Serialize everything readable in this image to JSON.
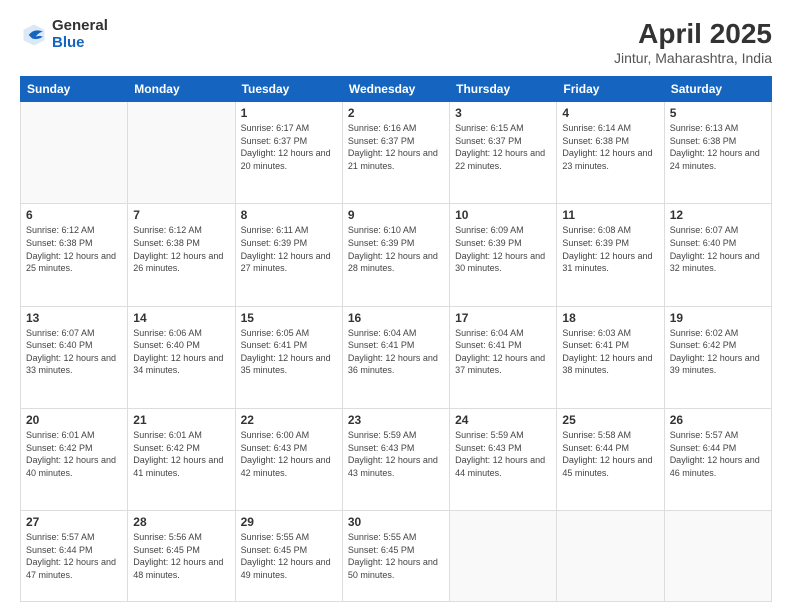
{
  "logo": {
    "general": "General",
    "blue": "Blue"
  },
  "header": {
    "title": "April 2025",
    "subtitle": "Jintur, Maharashtra, India"
  },
  "days": [
    "Sunday",
    "Monday",
    "Tuesday",
    "Wednesday",
    "Thursday",
    "Friday",
    "Saturday"
  ],
  "weeks": [
    [
      {
        "day": "",
        "info": ""
      },
      {
        "day": "",
        "info": ""
      },
      {
        "day": "1",
        "info": "Sunrise: 6:17 AM\nSunset: 6:37 PM\nDaylight: 12 hours and 20 minutes."
      },
      {
        "day": "2",
        "info": "Sunrise: 6:16 AM\nSunset: 6:37 PM\nDaylight: 12 hours and 21 minutes."
      },
      {
        "day": "3",
        "info": "Sunrise: 6:15 AM\nSunset: 6:37 PM\nDaylight: 12 hours and 22 minutes."
      },
      {
        "day": "4",
        "info": "Sunrise: 6:14 AM\nSunset: 6:38 PM\nDaylight: 12 hours and 23 minutes."
      },
      {
        "day": "5",
        "info": "Sunrise: 6:13 AM\nSunset: 6:38 PM\nDaylight: 12 hours and 24 minutes."
      }
    ],
    [
      {
        "day": "6",
        "info": "Sunrise: 6:12 AM\nSunset: 6:38 PM\nDaylight: 12 hours and 25 minutes."
      },
      {
        "day": "7",
        "info": "Sunrise: 6:12 AM\nSunset: 6:38 PM\nDaylight: 12 hours and 26 minutes."
      },
      {
        "day": "8",
        "info": "Sunrise: 6:11 AM\nSunset: 6:39 PM\nDaylight: 12 hours and 27 minutes."
      },
      {
        "day": "9",
        "info": "Sunrise: 6:10 AM\nSunset: 6:39 PM\nDaylight: 12 hours and 28 minutes."
      },
      {
        "day": "10",
        "info": "Sunrise: 6:09 AM\nSunset: 6:39 PM\nDaylight: 12 hours and 30 minutes."
      },
      {
        "day": "11",
        "info": "Sunrise: 6:08 AM\nSunset: 6:39 PM\nDaylight: 12 hours and 31 minutes."
      },
      {
        "day": "12",
        "info": "Sunrise: 6:07 AM\nSunset: 6:40 PM\nDaylight: 12 hours and 32 minutes."
      }
    ],
    [
      {
        "day": "13",
        "info": "Sunrise: 6:07 AM\nSunset: 6:40 PM\nDaylight: 12 hours and 33 minutes."
      },
      {
        "day": "14",
        "info": "Sunrise: 6:06 AM\nSunset: 6:40 PM\nDaylight: 12 hours and 34 minutes."
      },
      {
        "day": "15",
        "info": "Sunrise: 6:05 AM\nSunset: 6:41 PM\nDaylight: 12 hours and 35 minutes."
      },
      {
        "day": "16",
        "info": "Sunrise: 6:04 AM\nSunset: 6:41 PM\nDaylight: 12 hours and 36 minutes."
      },
      {
        "day": "17",
        "info": "Sunrise: 6:04 AM\nSunset: 6:41 PM\nDaylight: 12 hours and 37 minutes."
      },
      {
        "day": "18",
        "info": "Sunrise: 6:03 AM\nSunset: 6:41 PM\nDaylight: 12 hours and 38 minutes."
      },
      {
        "day": "19",
        "info": "Sunrise: 6:02 AM\nSunset: 6:42 PM\nDaylight: 12 hours and 39 minutes."
      }
    ],
    [
      {
        "day": "20",
        "info": "Sunrise: 6:01 AM\nSunset: 6:42 PM\nDaylight: 12 hours and 40 minutes."
      },
      {
        "day": "21",
        "info": "Sunrise: 6:01 AM\nSunset: 6:42 PM\nDaylight: 12 hours and 41 minutes."
      },
      {
        "day": "22",
        "info": "Sunrise: 6:00 AM\nSunset: 6:43 PM\nDaylight: 12 hours and 42 minutes."
      },
      {
        "day": "23",
        "info": "Sunrise: 5:59 AM\nSunset: 6:43 PM\nDaylight: 12 hours and 43 minutes."
      },
      {
        "day": "24",
        "info": "Sunrise: 5:59 AM\nSunset: 6:43 PM\nDaylight: 12 hours and 44 minutes."
      },
      {
        "day": "25",
        "info": "Sunrise: 5:58 AM\nSunset: 6:44 PM\nDaylight: 12 hours and 45 minutes."
      },
      {
        "day": "26",
        "info": "Sunrise: 5:57 AM\nSunset: 6:44 PM\nDaylight: 12 hours and 46 minutes."
      }
    ],
    [
      {
        "day": "27",
        "info": "Sunrise: 5:57 AM\nSunset: 6:44 PM\nDaylight: 12 hours and 47 minutes."
      },
      {
        "day": "28",
        "info": "Sunrise: 5:56 AM\nSunset: 6:45 PM\nDaylight: 12 hours and 48 minutes."
      },
      {
        "day": "29",
        "info": "Sunrise: 5:55 AM\nSunset: 6:45 PM\nDaylight: 12 hours and 49 minutes."
      },
      {
        "day": "30",
        "info": "Sunrise: 5:55 AM\nSunset: 6:45 PM\nDaylight: 12 hours and 50 minutes."
      },
      {
        "day": "",
        "info": ""
      },
      {
        "day": "",
        "info": ""
      },
      {
        "day": "",
        "info": ""
      }
    ]
  ]
}
